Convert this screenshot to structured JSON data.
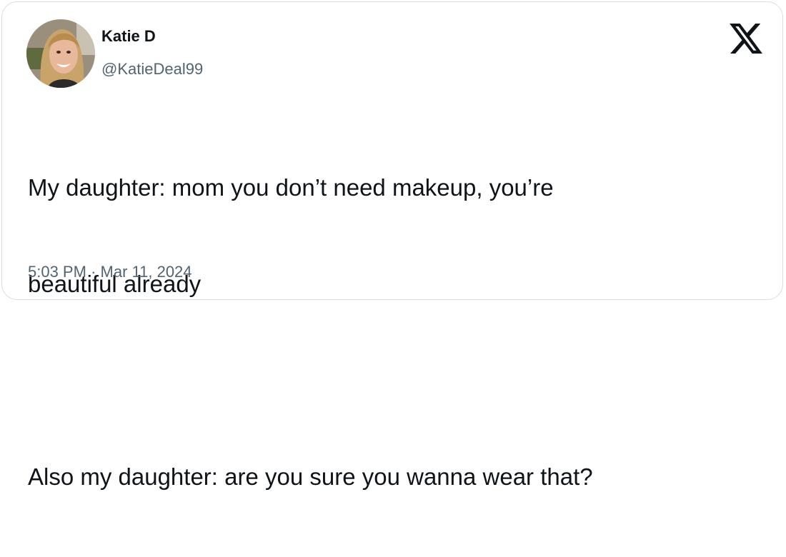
{
  "author": {
    "name": "Katie D",
    "handle": "@KatieDeal99"
  },
  "brand_icon": "x-logo-icon",
  "tweet": {
    "lines": [
      "My daughter: mom you don’t need makeup, you’re",
      "beautiful already",
      "",
      "Also my daughter: are you sure you wanna wear that?"
    ]
  },
  "meta": {
    "time": "5:03 PM",
    "separator": "·",
    "date": "Mar 11, 2024"
  },
  "colors": {
    "text_primary": "#0f1419",
    "text_secondary": "#536471",
    "border": "#d9dde1"
  }
}
